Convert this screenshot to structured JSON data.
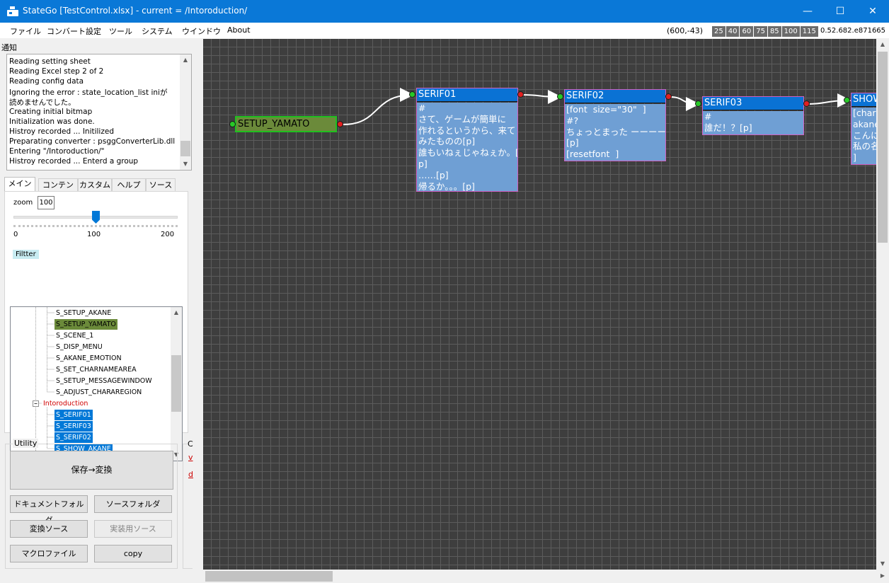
{
  "window": {
    "title": "StateGo  [TestControl.xlsx] - current = /Intoroduction/",
    "minimize": "—",
    "maximize": "☐",
    "close": "✕"
  },
  "menu": [
    "ファイル",
    "コンバート設定",
    "ツール",
    "システム",
    "ウインドウ",
    "About"
  ],
  "status": {
    "coords": "(600,-43)",
    "zoom_presets": [
      "25",
      "40",
      "60",
      "75",
      "85",
      "100",
      "115"
    ],
    "version": "0.52.682.e871665"
  },
  "notifications": {
    "label": "通知",
    "lines": [
      "Reading setting sheet",
      "Reading Excel step 2 of 2",
      "Reading config data",
      "Ignoring the error : state_location_list iniが",
      "読めませんでした。",
      "Creating initial bitmap",
      "Initialization was done.",
      "Histroy recorded ... Initilized",
      "Preparating converter : psggConverterLib.dll",
      "Entering \"/Intoroduction/\"",
      "Histroy recorded ... Enterd a group"
    ]
  },
  "tabs": [
    "メイン",
    "コンテンツ",
    "カスタム",
    "ヘルプ",
    "ソース"
  ],
  "zoom": {
    "label": "zoom",
    "value": "100",
    "level": 100,
    "min_label": "0",
    "mid_label": "100",
    "max_label": "200"
  },
  "filter_label": "Filtter",
  "tree": {
    "items": [
      "S_SETUP_AKANE",
      "S_SETUP_YAMATO",
      "S_SCENE_1",
      "S_DISP_MENU",
      "S_AKANE_EMOTION",
      "S_SET_CHARNAMEAREA",
      "S_SETUP_MESSAGEWINDOW",
      "S_ADJUST_CHARAREGION"
    ],
    "group": "Intoroduction",
    "group_items": [
      "S_SERIF01",
      "S_SERIF03",
      "S_SERIF02",
      "S_SHOW_AKANE"
    ]
  },
  "utility": {
    "label": "Utility",
    "save_convert": "保存→変換",
    "doc_folder": "ドキュメントフォルダ",
    "src_folder": "ソースフォルダ",
    "convert_src": "変換ソース",
    "impl_src": "実装用ソース",
    "macro_file": "マクロファイル",
    "copy": "copy"
  },
  "side": {
    "label": "C",
    "link1": "v",
    "link2": "d"
  },
  "nodes": {
    "setup": "SETUP_YAMATO",
    "serif01": {
      "title": "SERIF01",
      "body": "#\nさて、ゲームが簡単に\n作れるというから、来て\nみたものの[p]\n誰もいねぇじゃねぇか。[\np]\n……[p]\n帰るか。。。[p]"
    },
    "serif02": {
      "title": "SERIF02",
      "body": "[font  size=\"30\"  ]\n#?\nちょっとまった ーーーーー\n[p]\n[resetfont  ]"
    },
    "serif03": {
      "title": "SERIF03",
      "body": "#\n誰だ！？[p]"
    },
    "show": {
      "title": "SHOW_AKANE",
      "body": "[chara_show name=\"akane\"]\nakane:\nこんにちは\n私の名前は\n]"
    }
  },
  "colors": {
    "titlebar": "#0a78d7",
    "node_header": "#0a72d4",
    "node_body": "#6f9fd4",
    "setup_node": "#6b8a3a",
    "canvas": "#3e3e3e"
  }
}
